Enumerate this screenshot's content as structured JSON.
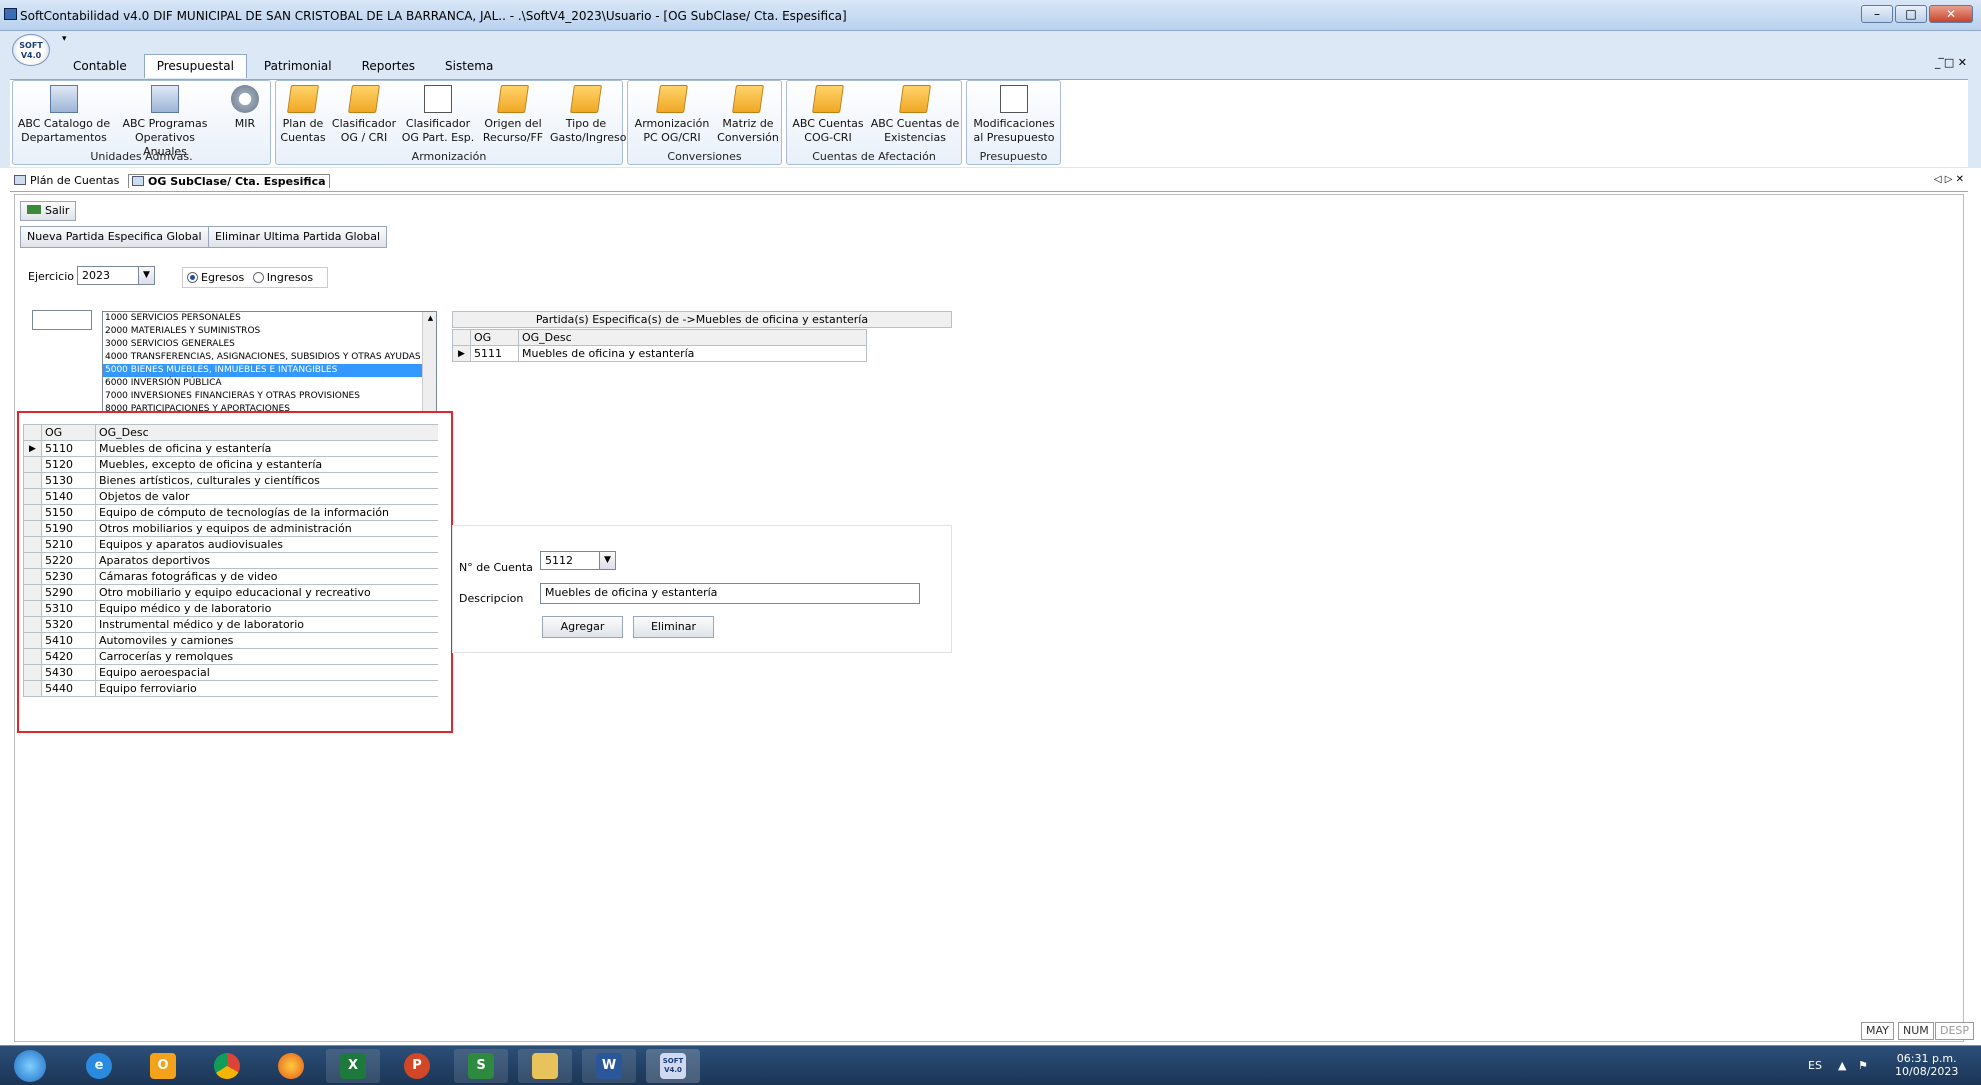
{
  "window": {
    "title": "SoftContabilidad v4.0 DIF MUNICIPAL DE SAN CRISTOBAL DE LA BARRANCA, JAL.. - .\\SoftV4_2023\\Usuario - [OG SubClase/ Cta. Espesifica]",
    "min": "–",
    "max": "□",
    "close": "✕",
    "logo": "SOFT V4.0"
  },
  "ribbon": {
    "tabs": [
      "Contable",
      "Presupuestal",
      "Patrimonial",
      "Reportes",
      "Sistema"
    ],
    "groups": [
      {
        "label": "Unidades Admvas.",
        "buttons": [
          {
            "label": "ABC Catalogo de Departamentos",
            "icon": "book-icon"
          },
          {
            "label": "ABC Programas Operativos Anuales",
            "icon": "book-icon"
          },
          {
            "label": "MIR",
            "icon": "gear-icon"
          }
        ]
      },
      {
        "label": "Armonización",
        "buttons": [
          {
            "label": "Plan de Cuentas",
            "icon": "folder-icon"
          },
          {
            "label": "Clasificador OG / CRI",
            "icon": "folder-icon"
          },
          {
            "label": "Clasificador OG Part. Esp.",
            "icon": "document-edit-icon"
          },
          {
            "label": "Origen del Recurso/FF",
            "icon": "folder-icon"
          },
          {
            "label": "Tipo de Gasto/Ingreso",
            "icon": "folder-icon"
          }
        ]
      },
      {
        "label": "Conversiones",
        "buttons": [
          {
            "label": "Armonización PC OG/CRI",
            "icon": "folder-icon"
          },
          {
            "label": "Matriz de Conversión",
            "icon": "folder-icon"
          }
        ]
      },
      {
        "label": "Cuentas de Afectación",
        "buttons": [
          {
            "label": "ABC Cuentas COG-CRI",
            "icon": "folder-icon"
          },
          {
            "label": "ABC Cuentas de Existencias",
            "icon": "folder-icon"
          }
        ]
      },
      {
        "label": "Presupuesto",
        "buttons": [
          {
            "label": "Modificaciones al Presupuesto",
            "icon": "document-gear-icon"
          }
        ]
      }
    ],
    "mdi_controls": "_ ̅□ ✕"
  },
  "doc_tabs": [
    "Plán de Cuentas",
    "OG SubClase/ Cta. Espesifica"
  ],
  "doc_nav": "◁ ▷ ✕",
  "toolbar": {
    "salir": "Salir",
    "nueva": "Nueva Partida Especifica Global",
    "eliminar_ultima": "Eliminar Ultima Partida Global"
  },
  "filters": {
    "ejercicio_label": "Ejercicio",
    "ejercicio_value": "2023",
    "egresos": "Egresos",
    "ingresos": "Ingresos",
    "selected": "Egresos"
  },
  "class_list": [
    "1000 SERVICIOS PERSONALES",
    "2000 MATERIALES Y SUMINISTROS",
    "3000 SERVICIOS GENERALES",
    "4000 TRANSFERENCIAS, ASIGNACIONES, SUBSIDIOS Y OTRAS  AYUDAS",
    "5000 BIENES MUEBLES, INMUEBLES E INTANGIBLES",
    "6000 INVERSIÓN PÚBLICA",
    "7000 INVERSIONES FINANCIERAS Y OTRAS PROVISIONES",
    "8000 PARTICIPACIONES Y APORTACIONES"
  ],
  "class_selected_index": 4,
  "og_grid": {
    "headers": [
      "OG",
      "OG_Desc"
    ],
    "rows": [
      [
        "5110",
        "Muebles de oficina y estantería"
      ],
      [
        "5120",
        "Muebles, excepto de oficina y estantería"
      ],
      [
        "5130",
        "Bienes artísticos, culturales y científicos"
      ],
      [
        "5140",
        "Objetos de valor"
      ],
      [
        "5150",
        "Equipo de cómputo de tecnologías de la información"
      ],
      [
        "5190",
        "Otros mobiliarios y equipos de administración"
      ],
      [
        "5210",
        "Equipos y aparatos audiovisuales"
      ],
      [
        "5220",
        "Aparatos deportivos"
      ],
      [
        "5230",
        "Cámaras fotográficas y de video"
      ],
      [
        "5290",
        "Otro mobiliario y equipo educacional y recreativo"
      ],
      [
        "5310",
        "Equipo médico y de laboratorio"
      ],
      [
        "5320",
        "Instrumental médico y de laboratorio"
      ],
      [
        "5410",
        "Automoviles y camiones"
      ],
      [
        "5420",
        "Carrocerías  y remolques"
      ],
      [
        "5430",
        "Equipo aeroespacial"
      ],
      [
        "5440",
        "Equipo ferroviario"
      ]
    ]
  },
  "partida_grid": {
    "caption": "Partida(s) Especifica(s) de ->Muebles de oficina y estantería",
    "headers": [
      "OG",
      "OG_Desc"
    ],
    "rows": [
      [
        "5111",
        "Muebles de oficina y estantería"
      ]
    ]
  },
  "form": {
    "cuenta_label": "N° de Cuenta",
    "cuenta_value": "5112",
    "desc_label": "Descripcion",
    "desc_value": "Muebles de oficina y estantería",
    "agregar": "Agregar",
    "eliminar": "Eliminar"
  },
  "status": [
    "MAY",
    "NUM",
    "DESP"
  ],
  "taskbar": {
    "apps": [
      "start-orb",
      "internet-explorer",
      "outlook",
      "chrome",
      "firefox",
      "excel",
      "powerpoint",
      "softcontabilidad-s",
      "file-explorer",
      "word",
      "softv4"
    ],
    "lang": "ES",
    "time": "06:31 p.m.",
    "date": "10/08/2023"
  }
}
